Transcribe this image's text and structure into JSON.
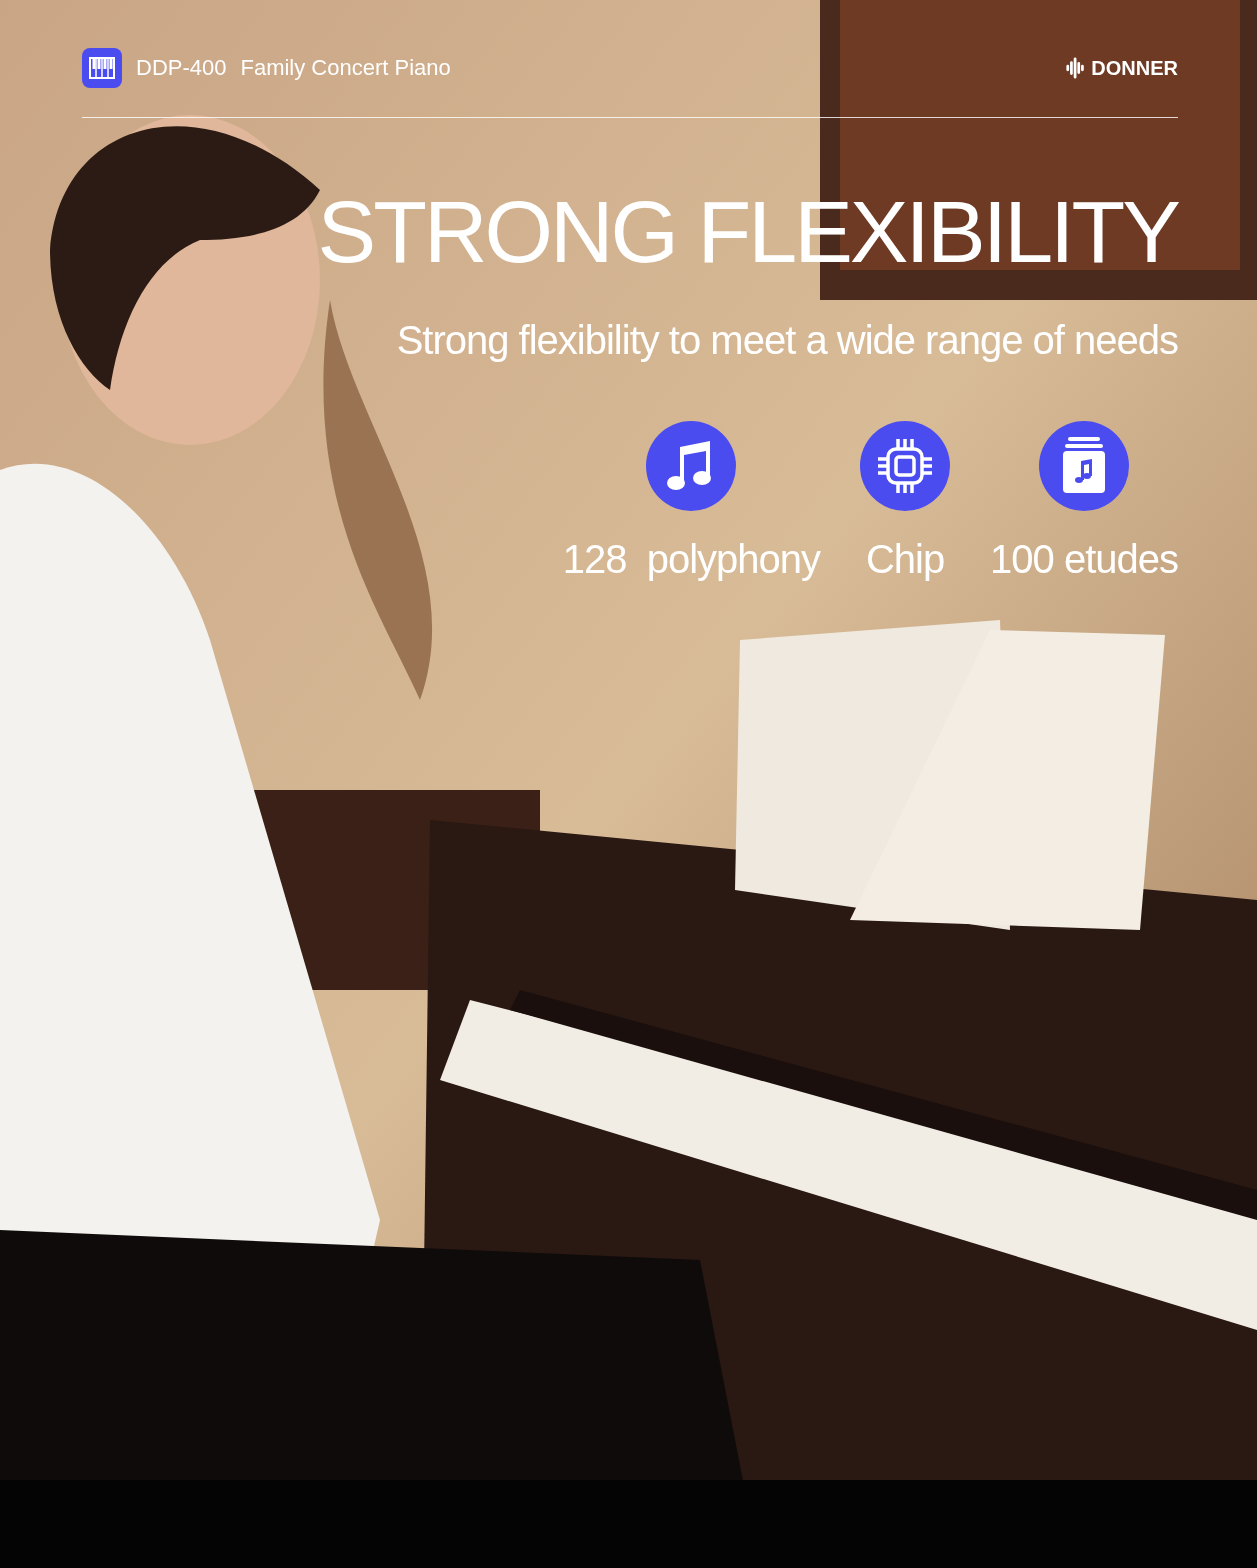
{
  "header": {
    "product_model": "DDP-400",
    "product_name": "Family Concert Piano",
    "brand": "DONNER"
  },
  "headline": "STRONG FLEXIBILITY",
  "subheadline": "Strong flexibility to meet a wide range of needs",
  "features": [
    {
      "kind": "music",
      "label": "128  polyphony"
    },
    {
      "kind": "chip",
      "label": "Chip"
    },
    {
      "kind": "album",
      "label": "100 etudes"
    }
  ]
}
